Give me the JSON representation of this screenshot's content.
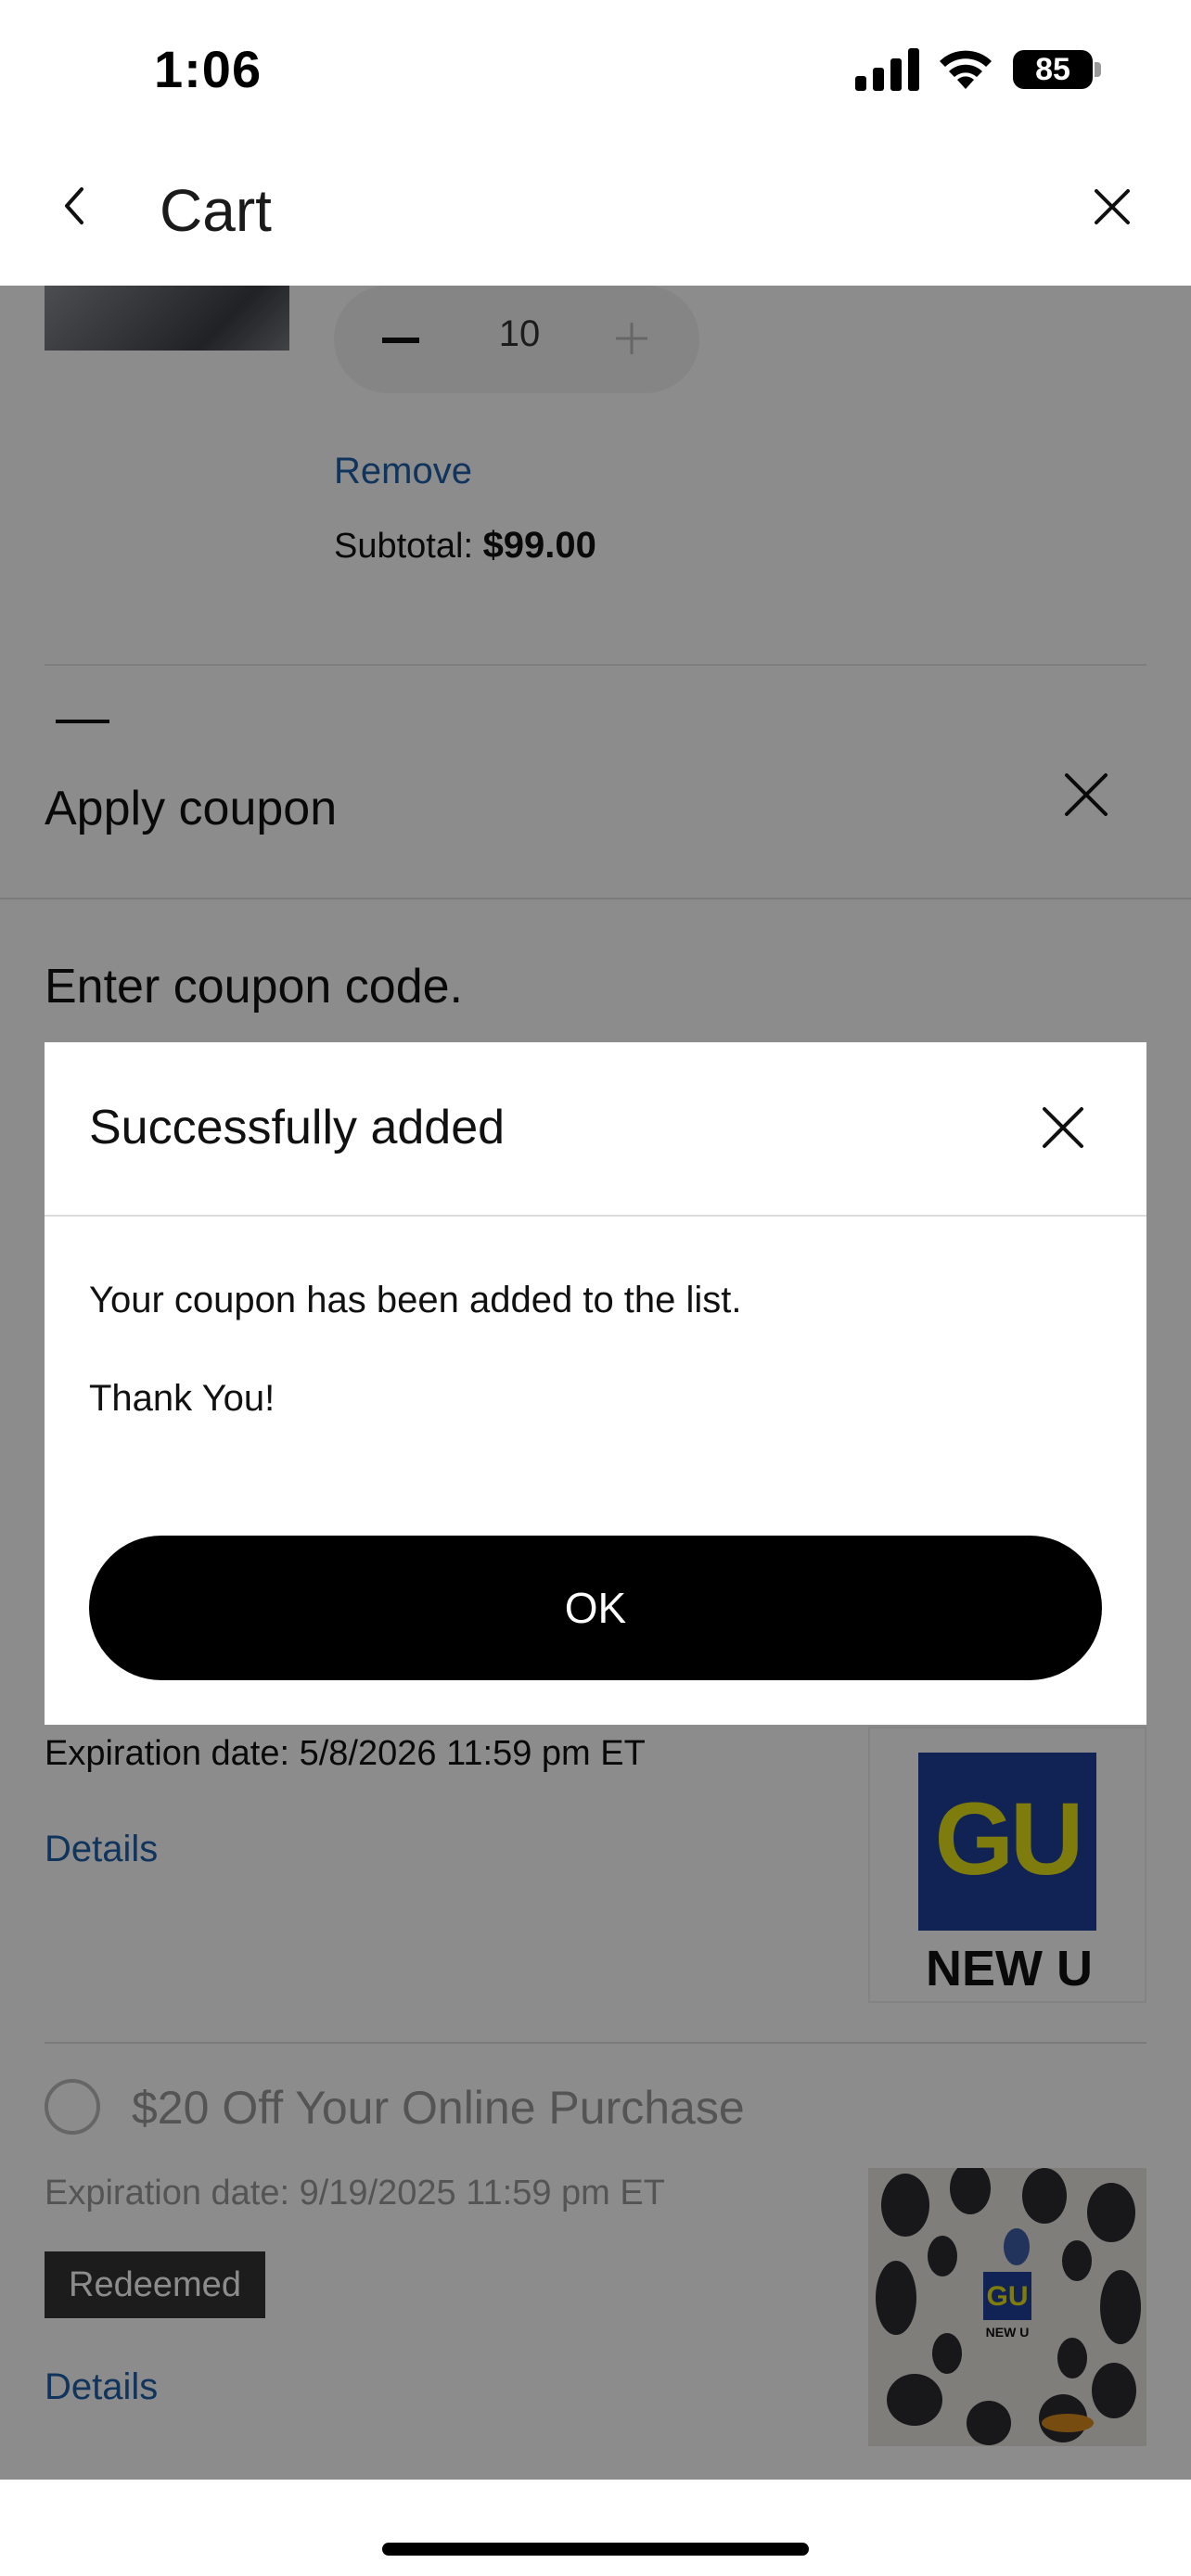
{
  "status_bar": {
    "time": "1:06",
    "battery": "85"
  },
  "nav": {
    "title": "Cart"
  },
  "cart_item": {
    "quantity": "10",
    "remove_label": "Remove",
    "subtotal_label": "Subtotal:",
    "subtotal_value": "$99.00"
  },
  "coupon_sheet": {
    "title": "Apply coupon",
    "prompt": "Enter coupon code.",
    "coupons": [
      {
        "expiration": "Expiration date: 5/8/2026 11:59 pm ET",
        "details_label": "Details",
        "logo_text": "GU",
        "logo_subtext": "NEW U"
      },
      {
        "title": "$20 Off Your Online Purchase",
        "expiration": "Expiration date: 9/19/2025 11:59 pm ET",
        "badge": "Redeemed",
        "details_label": "Details"
      }
    ]
  },
  "modal": {
    "title": "Successfully added",
    "message": "Your coupon has been added to the list.",
    "thanks": "Thank You!",
    "ok_label": "OK"
  },
  "colors": {
    "link": "#1f5fa8",
    "button_bg": "#000000",
    "gu_blue": "#20409a",
    "gu_yellow": "#e5e219"
  }
}
